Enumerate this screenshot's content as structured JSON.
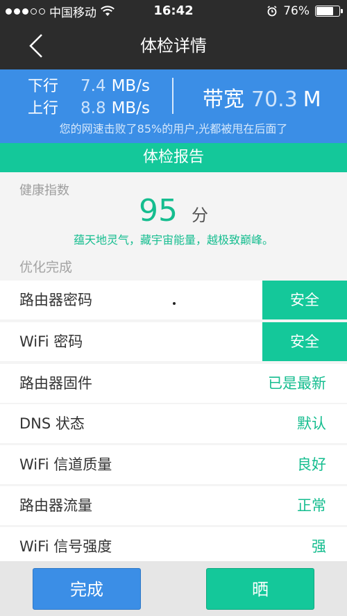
{
  "statusbar": {
    "carrier": "中国移动",
    "time": "16:42",
    "battery_pct_text": "76%",
    "battery_level": 0.76
  },
  "nav": {
    "title": "体检详情"
  },
  "speed": {
    "down_label": "下行",
    "down_value": "7.4",
    "down_unit": "MB/s",
    "up_label": "上行",
    "up_value": "8.8",
    "up_unit": "MB/s",
    "bandwidth_label": "带宽",
    "bandwidth_value": "70.3",
    "bandwidth_unit": "M",
    "note": "您的网速击败了85%的用户,光都被甩在后面了"
  },
  "report": {
    "title": "体检报告"
  },
  "health": {
    "label": "健康指数",
    "score": "95",
    "unit": "分",
    "slogan": "蕴天地灵气，藏宇宙能量，越极致巅峰。"
  },
  "optimize": {
    "header": "优化完成",
    "items": [
      {
        "name": "路由器密码",
        "status": "安全"
      },
      {
        "name": "WiFi 密码",
        "status": "安全"
      },
      {
        "name": "路由器固件",
        "status": "已是最新"
      },
      {
        "name": "DNS 状态",
        "status": "默认"
      },
      {
        "name": "WiFi 信道质量",
        "status": "良好"
      },
      {
        "name": "路由器流量",
        "status": "正常"
      },
      {
        "name": "WiFi 信号强度",
        "status": "强"
      }
    ]
  },
  "buttons": {
    "done": "完成",
    "share": "晒"
  },
  "colors": {
    "accent_green": "#14c89a",
    "accent_blue": "#3b8ee6",
    "dark_bar": "#2c2c2c"
  }
}
